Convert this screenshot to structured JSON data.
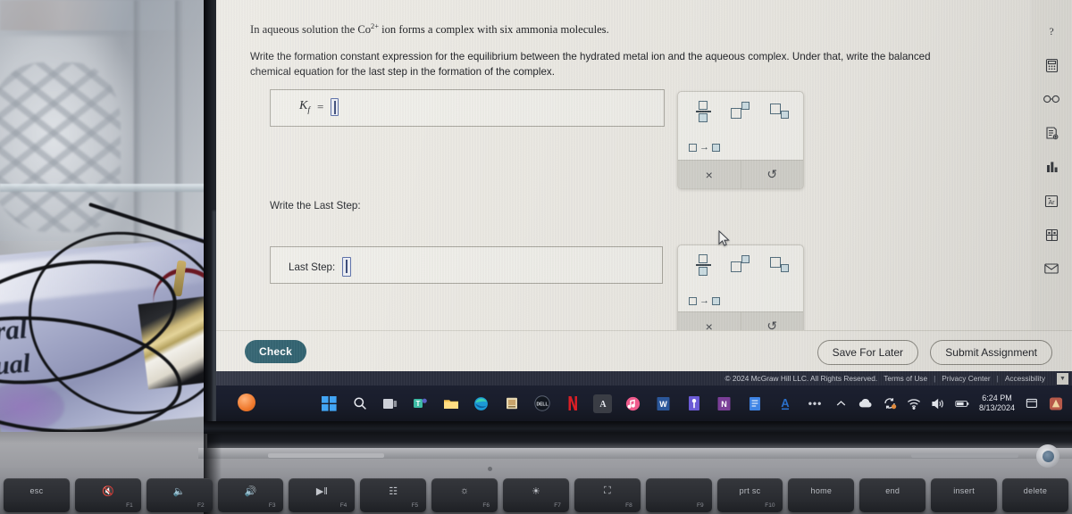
{
  "problem": {
    "line1_prefix": "In aqueous solution the Co",
    "line1_charge": "2+",
    "line1_suffix": " ion forms a complex with six ammonia molecules.",
    "line2": "Write the formation constant expression for the equilibrium between the hydrated metal ion and the aqueous complex. Under that, write the balanced chemical equation for the last step in the formation of the complex."
  },
  "answers": {
    "kf_symbol": "K",
    "kf_subscript": "f",
    "equals": "=",
    "last_step_prompt": "Write the Last Step:",
    "last_step_label": "Last Step:"
  },
  "math_palette": {
    "buttons": [
      {
        "name": "fraction-button",
        "tooltip": "fraction"
      },
      {
        "name": "superscript-button",
        "tooltip": "superscript"
      },
      {
        "name": "subscript-button",
        "tooltip": "subscript"
      },
      {
        "name": "reaction-arrow-button",
        "tooltip": "reaction arrow"
      }
    ],
    "clear_glyph": "×",
    "undo_glyph": "↺"
  },
  "toolbar": {
    "check_label": "Check",
    "save_label": "Save For Later",
    "submit_label": "Submit Assignment"
  },
  "footer": {
    "copyright": "© 2024 McGraw Hill LLC. All Rights Reserved.",
    "links": [
      "Terms of Use",
      "Privacy Center",
      "Accessibility"
    ],
    "separator": "|"
  },
  "tool_rail": [
    {
      "name": "help-icon",
      "label": "?"
    },
    {
      "name": "calculator-icon",
      "label": "Calculator"
    },
    {
      "name": "glasses-icon",
      "label": "Glasses"
    },
    {
      "name": "reference-sheet-icon",
      "label": "Reference"
    },
    {
      "name": "bar-chart-icon",
      "label": "Data"
    },
    {
      "name": "periodic-table-icon",
      "label": "Ar"
    },
    {
      "name": "molecular-model-icon",
      "label": "Model"
    },
    {
      "name": "mail-icon",
      "label": "Mail"
    }
  ],
  "taskbar": {
    "apps": [
      {
        "name": "start-button",
        "label": "",
        "color": "#2d7fd4"
      },
      {
        "name": "search-icon",
        "label": "",
        "color": "transparent"
      },
      {
        "name": "task-view-icon",
        "label": "",
        "color": "#b9bcc4"
      },
      {
        "name": "teams-icon",
        "label": "T",
        "color": "#4b53bc"
      },
      {
        "name": "file-explorer-icon",
        "label": "",
        "color": "#f0b429"
      },
      {
        "name": "edge-icon",
        "label": "",
        "color": "#1aa0d8"
      },
      {
        "name": "store-icon",
        "label": "",
        "color": "#e0c27a"
      },
      {
        "name": "dell-icon",
        "label": "DELL",
        "color": "#0f1620"
      },
      {
        "name": "netflix-icon",
        "label": "N",
        "color": "#d81f26"
      },
      {
        "name": "acrobat-icon",
        "label": "A",
        "color": "#3a3d45"
      },
      {
        "name": "music-icon",
        "label": "♪",
        "color": "#e8477d"
      },
      {
        "name": "word-icon",
        "label": "W",
        "color": "#2b579a"
      },
      {
        "name": "activity-icon",
        "label": "",
        "color": "#6b5bd6"
      },
      {
        "name": "onenote-icon",
        "label": "N",
        "color": "#7b3f98"
      },
      {
        "name": "docs-icon",
        "label": "",
        "color": "#3f84e4"
      },
      {
        "name": "reader-icon",
        "label": "A",
        "color": "#2a6fc9"
      },
      {
        "name": "overflow-icon",
        "label": "•••",
        "color": "transparent"
      }
    ],
    "tray": {
      "time": "6:24 PM",
      "date": "8/13/2024",
      "chevron": "∧"
    }
  },
  "keyboard": {
    "keys": [
      {
        "name": "key-esc",
        "main": "esc",
        "fn": ""
      },
      {
        "name": "key-f1-mute",
        "glyph": "🔇",
        "fn": "F1"
      },
      {
        "name": "key-f2-volume-down",
        "glyph": "🔉",
        "fn": "F2"
      },
      {
        "name": "key-f3-volume-up",
        "glyph": "🔊",
        "fn": "F3"
      },
      {
        "name": "key-f4-play-pause",
        "glyph": "▶‖",
        "fn": "F4"
      },
      {
        "name": "key-f5-keyboard-light",
        "glyph": "☷",
        "fn": "F5"
      },
      {
        "name": "key-f6-brightness-down",
        "glyph": "☀",
        "fn": "F6"
      },
      {
        "name": "key-f7-brightness-up",
        "glyph": "☀",
        "fn": "F7"
      },
      {
        "name": "key-f8-display",
        "glyph": "❐",
        "fn": "F8"
      },
      {
        "name": "key-f9",
        "glyph": "",
        "fn": "F9"
      },
      {
        "name": "key-print-screen",
        "main": "prt sc",
        "fn": "F10"
      },
      {
        "name": "key-home",
        "main": "home",
        "fn": ""
      },
      {
        "name": "key-end",
        "main": "end",
        "fn": ""
      },
      {
        "name": "key-insert",
        "main": "insert",
        "fn": ""
      },
      {
        "name": "key-delete",
        "main": "delete",
        "fn": ""
      }
    ]
  },
  "background_photo": {
    "book_word_1": "ral",
    "book_word_2": "ual"
  },
  "colors": {
    "check_button": "#2e606e",
    "legal_bar": "#2b2f3e",
    "screen_bg": "#eceae4",
    "taskbar": "#191d2b",
    "input_accent": "#5b6fa8"
  }
}
